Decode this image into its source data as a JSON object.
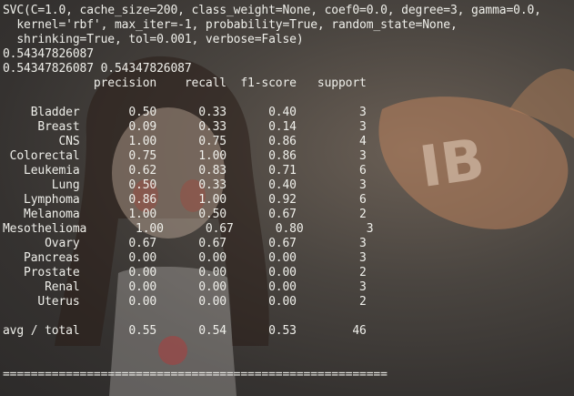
{
  "terminal": {
    "lines": [
      "SVC(C=1.0, cache_size=200, class_weight=None, coef0=0.0, degree=3, gamma=0.0,",
      "  kernel='rbf', max_iter=-1, probability=True, random_state=None,",
      "  shrinking=True, tol=0.001, verbose=False)",
      "0.54347826087",
      "0.54347826087 0.54347826087",
      "             precision    recall  f1-score   support",
      "",
      "    Bladder       0.50      0.33      0.40         3",
      "     Breast       0.09      0.33      0.14         3",
      "        CNS       1.00      0.75      0.86         4",
      " Colorectal       0.75      1.00      0.86         3",
      "   Leukemia       0.62      0.83      0.71         6",
      "       Lung       0.50      0.33      0.40         3",
      "   Lymphoma       0.86      1.00      0.92         6",
      "   Melanoma       1.00      0.50      0.67         2",
      "Mesothelioma       1.00      0.67      0.80         3",
      "      Ovary       0.67      0.67      0.67         3",
      "   Pancreas       0.00      0.00      0.00         3",
      "   Prostate       0.00      0.00      0.00         2",
      "      Renal       0.00      0.00      0.00         3",
      "     Uterus       0.00      0.00      0.00         2",
      "",
      "avg / total       0.55      0.54      0.53        46",
      "",
      "",
      "======================================================="
    ]
  },
  "colors": {
    "foreground": "#efefea",
    "background": "#3a3836",
    "wallpaper_accent": "#c98a5e"
  }
}
